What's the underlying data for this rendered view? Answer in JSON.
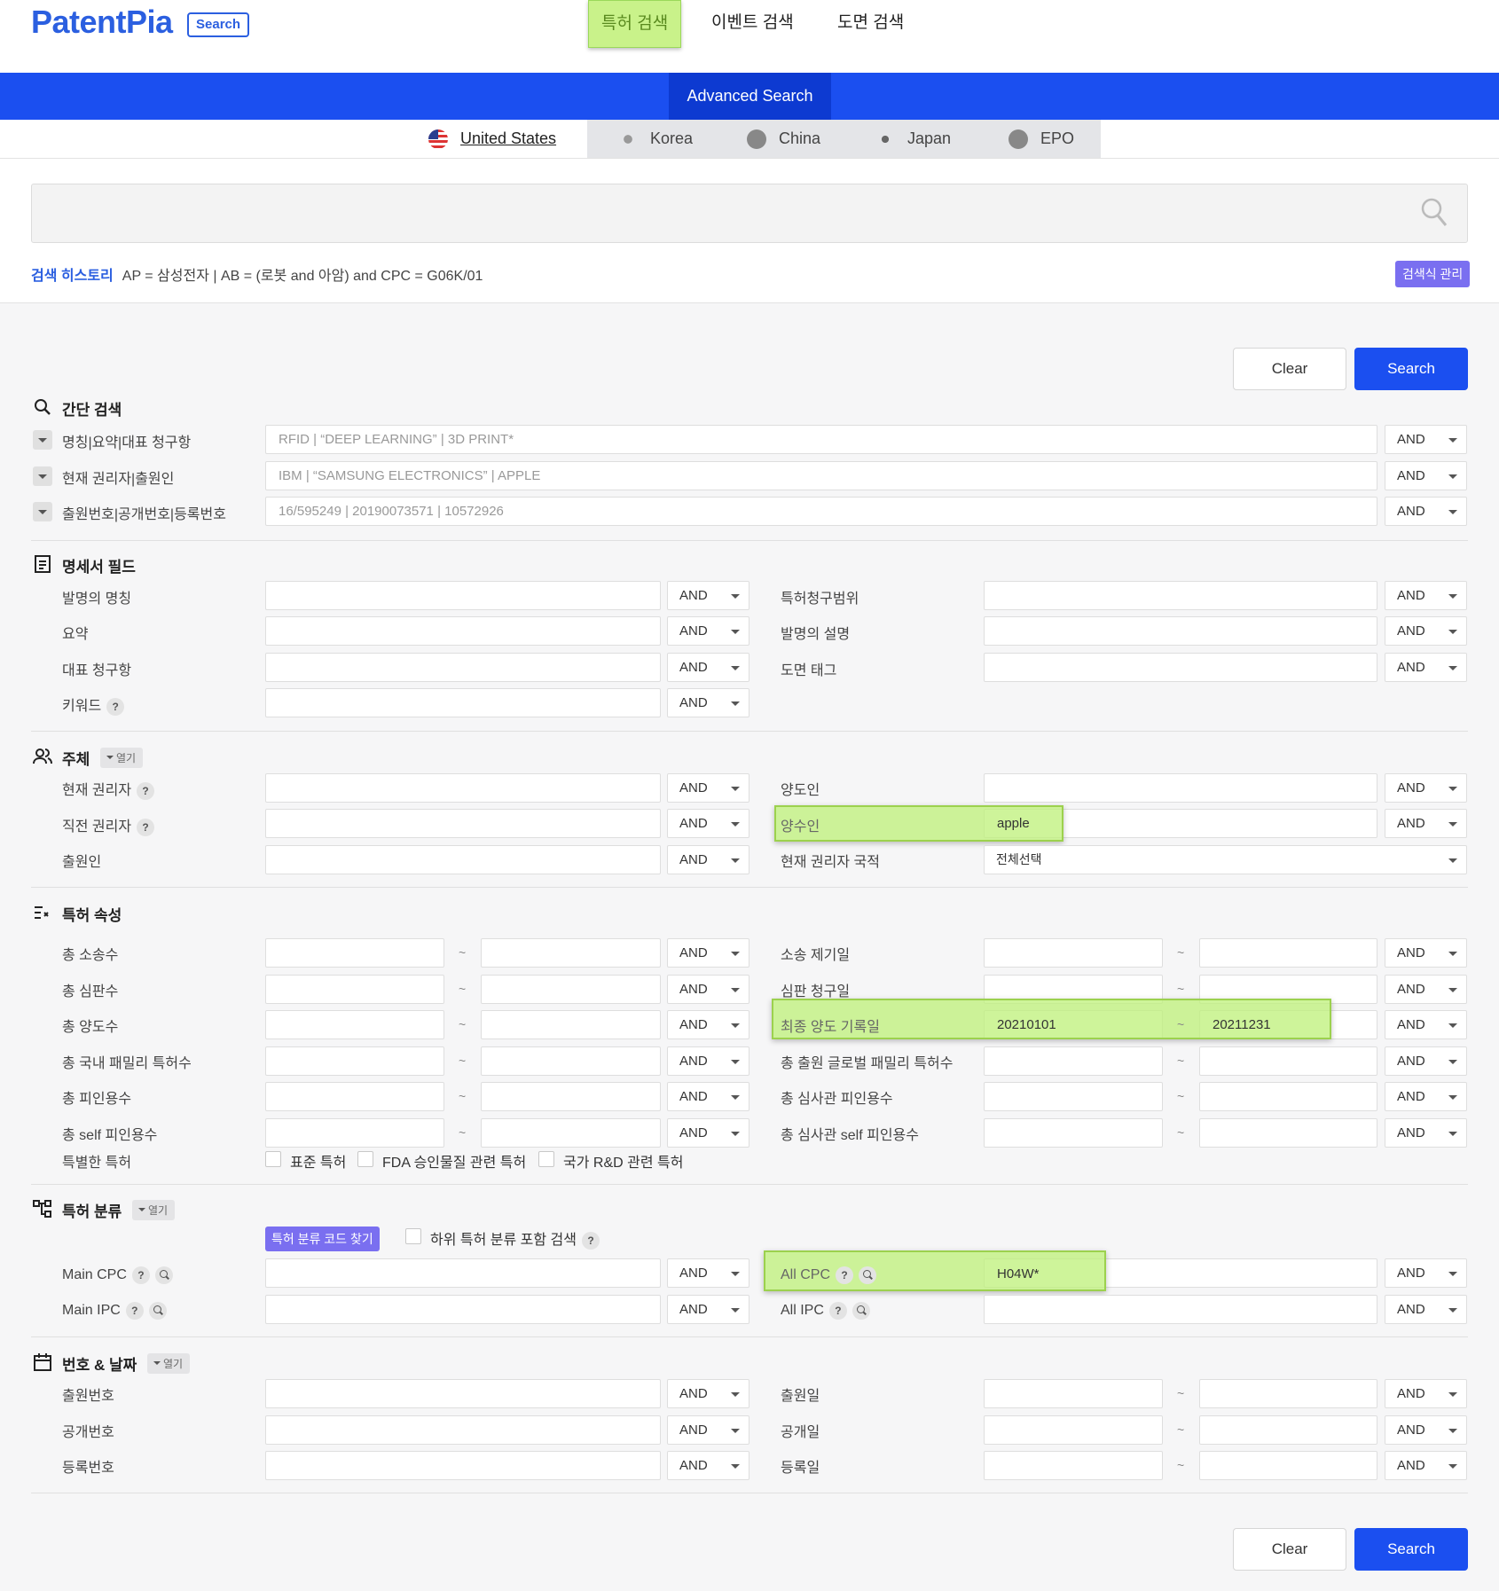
{
  "header": {
    "logo": "PatentPia",
    "logo_badge": "Search",
    "nav": [
      "특허 검색",
      "이벤트 검색",
      "도면 검색"
    ]
  },
  "advanced_label": "Advanced Search",
  "countries": [
    "United States",
    "Korea",
    "China",
    "Japan",
    "EPO"
  ],
  "history": {
    "label": "검색 히스토리",
    "text": "AP = 삼성전자 |  AB = (로봇 and 아암) and CPC = G06K/01",
    "manage": "검색식 관리"
  },
  "buttons": {
    "clear": "Clear",
    "search": "Search"
  },
  "op": "AND",
  "simple": {
    "title": "간단 검색",
    "rows": [
      {
        "label": "명칭|요약|대표 청구항",
        "placeholder": "RFID | “DEEP LEARNING” | 3D PRINT*"
      },
      {
        "label": "현재 권리자|출원인",
        "placeholder": "IBM | “SAMSUNG ELECTRONICS” | APPLE"
      },
      {
        "label": "출원번호|공개번호|등록번호",
        "placeholder": "16/595249 | 20190073571 | 10572926"
      }
    ]
  },
  "spec": {
    "title": "명세서 필드",
    "left": [
      "발명의 명칭",
      "요약",
      "대표 청구항",
      "키워드"
    ],
    "right": [
      "특허청구범위",
      "발명의 설명",
      "도면 태그"
    ]
  },
  "subject": {
    "title": "주체",
    "open": "열기",
    "left": [
      "현재 권리자",
      "직전 권리자",
      "출원인"
    ],
    "right": [
      "양도인",
      "양수인",
      "현재 권리자 국적"
    ],
    "assignee_value": "apple",
    "nationality_value": "전체선택"
  },
  "attr": {
    "title": "특허 속성",
    "left": [
      "총 소송수",
      "총 심판수",
      "총 양도수",
      "총 국내 패밀리 특허수",
      "총 피인용수",
      "총 self 피인용수"
    ],
    "right": [
      "소송 제기일",
      "심판 청구일",
      "최종 양도 기록일",
      "총 출원 글로벌 패밀리 특허수",
      "총 심사관 피인용수",
      "총 심사관 self 피인용수"
    ],
    "tilde": "~",
    "transfer_from": "20210101",
    "transfer_to": "20211231",
    "special_label": "특별한 특허",
    "special": [
      "표준 특허",
      "FDA 승인물질 관련 특허",
      "국가 R&D 관련 특허"
    ]
  },
  "cls": {
    "title": "특허 분류",
    "open": "열기",
    "code_btn": "특허 분류 코드 찾기",
    "sub_label": "하위 특허 분류 포함 검색",
    "main_cpc": "Main CPC",
    "main_ipc": "Main IPC",
    "all_cpc": "All CPC",
    "all_ipc": "All IPC",
    "all_cpc_value": "H04W*"
  },
  "num": {
    "title": "번호 & 날짜",
    "open": "열기",
    "left": [
      "출원번호",
      "공개번호",
      "등록번호"
    ],
    "right": [
      "출원일",
      "공개일",
      "등록일"
    ]
  },
  "colors": {
    "brand": "#1b4ff0",
    "highlight": "#c9f28a",
    "purple": "#7a6ff0"
  }
}
